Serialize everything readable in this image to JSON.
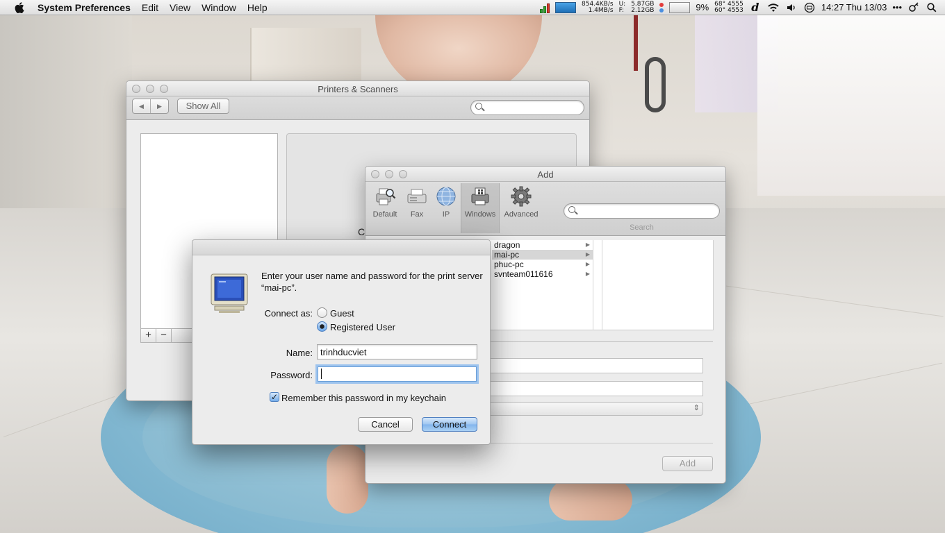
{
  "menubar": {
    "app_name": "System Preferences",
    "menus": [
      "Edit",
      "View",
      "Window",
      "Help"
    ],
    "net_up": "854.4KB/s",
    "net_down": "1.4MB/s",
    "disk_u_label": "U:",
    "disk_f_label": "F:",
    "disk_used": "5.87GB",
    "disk_free": "2.12GB",
    "cpu_percent": "9%",
    "temp_1": "68° 4555",
    "temp_2": "60° 4553",
    "clock": "14:27 Thu 13/03",
    "more": "•••"
  },
  "printers_window": {
    "title": "Printers & Scanners",
    "show_all": "Show All",
    "partial_text": "Cl",
    "add_button": "+",
    "remove_button": "−"
  },
  "add_window": {
    "title": "Add",
    "toolbar": [
      {
        "label": "Default",
        "icon": "printer-search-icon"
      },
      {
        "label": "Fax",
        "icon": "fax-icon"
      },
      {
        "label": "IP",
        "icon": "globe-icon"
      },
      {
        "label": "Windows",
        "icon": "windows-printer-icon"
      },
      {
        "label": "Advanced",
        "icon": "gear-icon"
      }
    ],
    "search_caption": "Search",
    "servers": [
      "dragon",
      "mai-pc",
      "phuc-pc",
      "svnteam011616"
    ],
    "selected_server": "mai-pc",
    "add_button": "Add"
  },
  "auth_dialog": {
    "message": "Enter your user name and password for the print server “mai-pc”.",
    "connect_as_label": "Connect as:",
    "option_guest": "Guest",
    "option_registered": "Registered User",
    "selected_option": "Registered User",
    "name_label": "Name:",
    "name_value": "trinhducviet",
    "password_label": "Password:",
    "password_value": "",
    "remember_label": "Remember this password in my keychain",
    "remember_checked": true,
    "cancel_button": "Cancel",
    "connect_button": "Connect"
  },
  "colors": {
    "accent": "#82b5ec",
    "focus_ring": "#9ec4ee",
    "battery_green": "#2da12d"
  }
}
